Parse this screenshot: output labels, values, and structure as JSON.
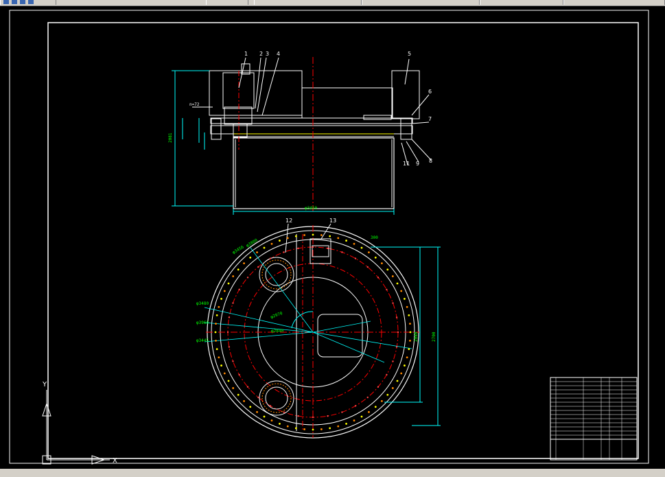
{
  "balloons": {
    "b1": "1",
    "b2": "2",
    "b3": "3",
    "b4": "4",
    "b5": "5",
    "b6": "6",
    "b7": "7",
    "b8": "8",
    "b9": "9",
    "b11": "11",
    "b12": "12",
    "b13": "13"
  },
  "dims": {
    "n72": "n=72",
    "width_bottom": "φ3450",
    "height_left": "2081",
    "right_inner": "2040",
    "right_outer": "2700",
    "top_right": "300",
    "d1": "φ3456",
    "d2": "φ3800",
    "d3": "φ3480",
    "d4": "φ3960",
    "d5": "φ3445",
    "d6": "φ2970",
    "d7": "φ2840"
  },
  "colors": {
    "outline": "#ffffff",
    "dimension": "#00ffff",
    "center": "#ff0000",
    "accent": "#ffff00",
    "bolt": "#ff8800",
    "text_green": "#00ff00",
    "border": "#ffffff"
  },
  "ucs": {
    "x_label": "X",
    "y_label": "Y"
  }
}
